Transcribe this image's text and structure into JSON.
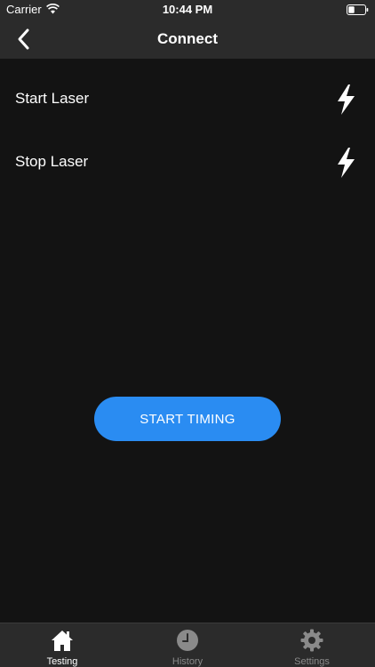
{
  "status_bar": {
    "carrier": "Carrier",
    "time": "10:44 PM",
    "wifi_icon": "wifi-icon",
    "battery_icon": "battery-icon"
  },
  "nav": {
    "title": "Connect",
    "back_icon": "chevron-left-icon"
  },
  "rows": [
    {
      "label": "Start Laser",
      "icon": "lightning-bolt-icon"
    },
    {
      "label": "Stop Laser",
      "icon": "lightning-bolt-icon"
    }
  ],
  "start_button": {
    "label": "START TIMING",
    "color": "#2a8cf2"
  },
  "tabs": [
    {
      "label": "Testing",
      "icon": "home-icon",
      "active": true
    },
    {
      "label": "History",
      "icon": "clock-icon",
      "active": false
    },
    {
      "label": "Settings",
      "icon": "gear-icon",
      "active": false
    }
  ],
  "colors": {
    "background": "#131313",
    "bar": "#2b2b2b",
    "active_tab": "#ffffff",
    "inactive_tab": "#8a8a8a"
  }
}
